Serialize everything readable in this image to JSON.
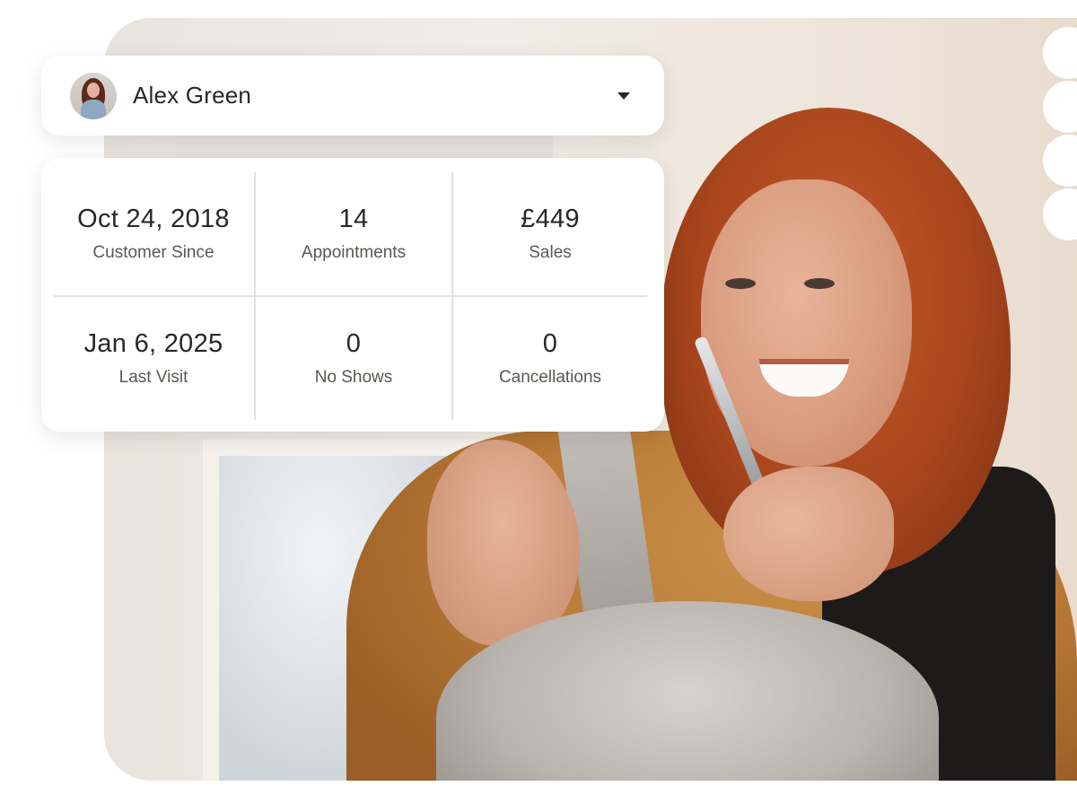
{
  "profile": {
    "name": "Alex Green",
    "avatar_icon": "avatar",
    "dropdown_icon": "caret-down-icon"
  },
  "stats": [
    {
      "value": "Oct 24, 2018",
      "label": "Customer Since"
    },
    {
      "value": "14",
      "label": "Appointments"
    },
    {
      "value": "£449",
      "label": "Sales"
    },
    {
      "value": "Jan 6, 2025",
      "label": "Last Visit"
    },
    {
      "value": "0",
      "label": "No Shows"
    },
    {
      "value": "0",
      "label": "Cancellations"
    }
  ],
  "colors": {
    "text_primary": "#2a2724",
    "text_secondary": "#5c5752",
    "card_bg": "#ffffff",
    "divider": "#e4e1de"
  }
}
